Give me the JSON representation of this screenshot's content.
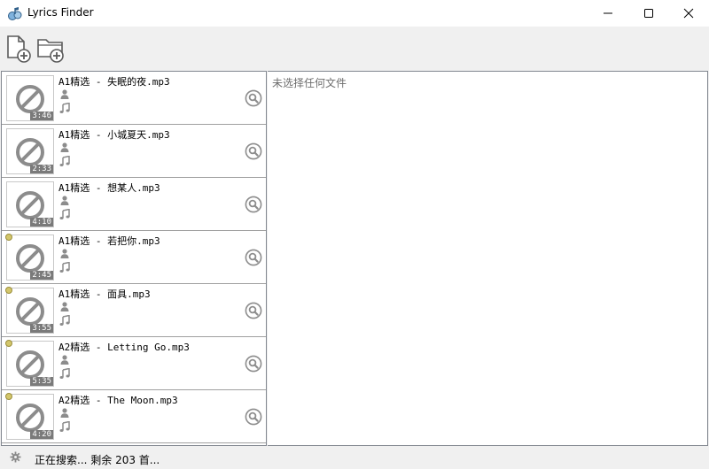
{
  "window": {
    "title": "Lyrics Finder",
    "app_icon": "lyrics-finder-app-icon",
    "controls": [
      "minimize-icon",
      "maximize-icon",
      "close-icon"
    ]
  },
  "toolbar": {
    "buttons": [
      {
        "name": "add-file-button",
        "icon": "file-plus-icon"
      },
      {
        "name": "add-folder-button",
        "icon": "folder-plus-icon"
      }
    ]
  },
  "file_list": [
    {
      "filename": "A1精选 - 失眠的夜.mp3",
      "duration": "3:46",
      "marked": false
    },
    {
      "filename": "A1精选 - 小城夏天.mp3",
      "duration": "2:33",
      "marked": false
    },
    {
      "filename": "A1精选 - 想某人.mp3",
      "duration": "4:10",
      "marked": false
    },
    {
      "filename": "A1精选 - 若把你.mp3",
      "duration": "2:45",
      "marked": true
    },
    {
      "filename": "A1精选 - 面具.mp3",
      "duration": "3:55",
      "marked": true
    },
    {
      "filename": "A2精选 - Letting Go.mp3",
      "duration": "5:35",
      "marked": true
    },
    {
      "filename": "A2精选 - The Moon.mp3",
      "duration": "4:20",
      "marked": true
    }
  ],
  "details": {
    "empty_text": "未选择任何文件"
  },
  "status": {
    "text": "正在搜索... 剩余 203 首..."
  },
  "colors": {
    "marker": "#d3c66b",
    "border": "#828790",
    "placeholder_gray": "#6d6d6d"
  }
}
